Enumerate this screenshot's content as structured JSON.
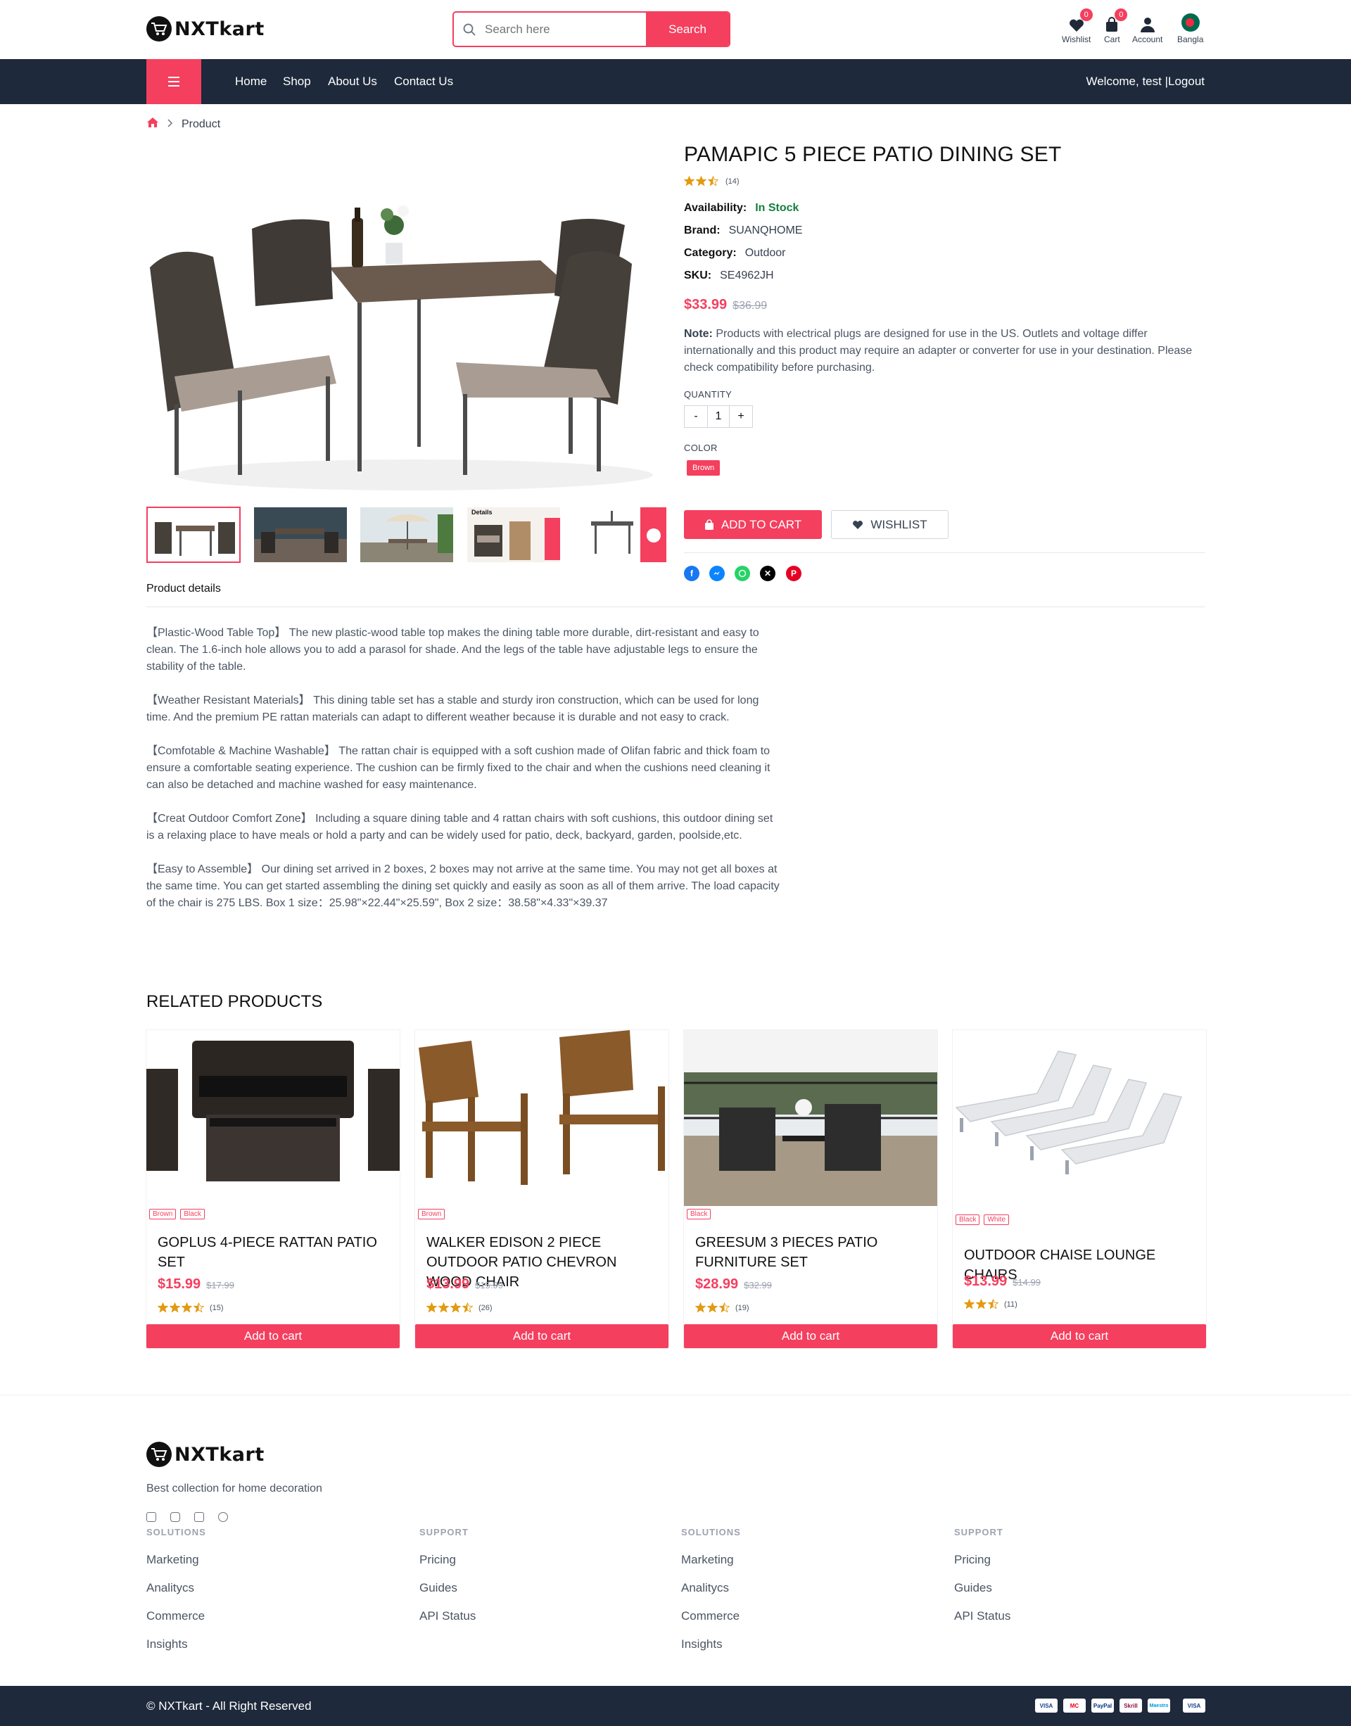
{
  "brand": {
    "name": "NXTkart",
    "accent": "#f43f5e",
    "dark": "#1e293b"
  },
  "search": {
    "placeholder": "Search here",
    "button": "Search"
  },
  "header_icons": [
    {
      "label": "Wishlist",
      "badge": "0",
      "icon": "heart-icon"
    },
    {
      "label": "Cart",
      "badge": "0",
      "icon": "shopping-bag-icon"
    },
    {
      "label": "Account",
      "icon": "user-icon"
    },
    {
      "label": "Bangla",
      "icon": "bangladesh-flag-icon"
    }
  ],
  "nav": {
    "links": [
      "Home",
      "Shop",
      "About Us",
      "Contact Us"
    ],
    "welcome": "Welcome, test |",
    "logout": "Logout"
  },
  "breadcrumb": {
    "current": "Product"
  },
  "product": {
    "title": "PAMAPIC 5 PIECE PATIO DINING SET",
    "rating": 2.5,
    "reviews": "(14)",
    "availability_label": "Availability:",
    "availability": "In Stock",
    "brand_label": "Brand:",
    "brand": "SUANQHOME",
    "category_label": "Category:",
    "category": "Outdoor",
    "sku_label": "SKU:",
    "sku": "SE4962JH",
    "price": "$33.99",
    "old_price": "$36.99",
    "note_label": "Note:",
    "note": "Products with electrical plugs are designed for use in the US. Outlets and voltage differ internationally and this product may require an adapter or converter for use in your destination. Please check compatibility before purchasing.",
    "quantity_label": "QUANTITY",
    "quantity": "1",
    "qty_minus": "-",
    "qty_plus": "+",
    "color_label": "COLOR",
    "color": "Brown",
    "add_to_cart": "ADD TO CART",
    "wishlist": "WISHLIST",
    "details_tab": "Product details",
    "share": [
      "facebook-icon",
      "messenger-icon",
      "whatsapp-icon",
      "x-icon",
      "pinterest-icon"
    ],
    "description": [
      "【Plastic-Wood Table Top】 The new plastic-wood table top makes the dining table more durable, dirt-resistant and easy to clean. The 1.6-inch hole allows you to add a parasol for shade. And the legs of the table have adjustable legs to ensure the stability of the table.",
      "【Weather Resistant Materials】 This dining table set has a stable and sturdy iron construction, which can be used for long time. And the premium PE rattan materials can adapt to different weather because it is durable and not easy to crack.",
      "【Comfotable & Machine Washable】 The rattan chair is equipped with a soft cushion made of Olifan fabric and thick foam to ensure a comfortable seating experience. The cushion can be firmly fixed to the chair and when the cushions need cleaning it can also be detached and machine washed for easy maintenance.",
      "【Creat Outdoor Comfort Zone】 Including a square dining table and 4 rattan chairs with soft cushions, this outdoor dining set is a relaxing place to have meals or hold a party and can be widely used for patio, deck, backyard, garden, poolside,etc.",
      "【Easy to Assemble】 Our dining set arrived in 2 boxes, 2 boxes may not arrive at the same time. You may not get all boxes at the same time. You can get started assembling the dining set quickly and easily as soon as all of them arrive. The load capacity of the chair is 275 LBS. Box 1 size：25.98\"×22.44\"×25.59\", Box 2 size：38.58\"×4.33\"×39.37"
    ],
    "thumb_caption": "Details"
  },
  "related": {
    "heading": "RELATED PRODUCTS",
    "add_label": "Add to cart",
    "items": [
      {
        "name": "GOPLUS 4-PIECE RATTAN PATIO SET",
        "price": "$15.99",
        "old": "$17.99",
        "rating": 3.5,
        "count": "(15)",
        "tags": [
          "Brown",
          "Black"
        ]
      },
      {
        "name": "WALKER EDISON 2 PIECE OUTDOOR PATIO CHEVRON WOOD CHAIR",
        "price": "$13.99",
        "old": "$15.99",
        "rating": 3.5,
        "count": "(26)",
        "tags": [
          "Brown"
        ]
      },
      {
        "name": "GREESUM 3 PIECES PATIO FURNITURE SET",
        "price": "$28.99",
        "old": "$32.99",
        "rating": 2.5,
        "count": "(19)",
        "tags": [
          "Black"
        ]
      },
      {
        "name": "OUTDOOR CHAISE LOUNGE CHAIRS",
        "price": "$13.99",
        "old": "$14.99",
        "rating": 2.5,
        "count": "(11)",
        "tags": [
          "Black",
          "White"
        ]
      }
    ]
  },
  "footer": {
    "tagline": "Best collection for home decoration",
    "social": [
      "facebook-icon",
      "instagram-icon",
      "twitter-icon",
      "github-icon"
    ],
    "columns": [
      {
        "heading": "SOLUTIONS",
        "links": [
          "Marketing",
          "Analitycs",
          "Commerce",
          "Insights"
        ]
      },
      {
        "heading": "SUPPORT",
        "links": [
          "Pricing",
          "Guides",
          "API Status"
        ]
      },
      {
        "heading": "SOLUTIONS",
        "links": [
          "Marketing",
          "Analitycs",
          "Commerce",
          "Insights"
        ]
      },
      {
        "heading": "SUPPORT",
        "links": [
          "Pricing",
          "Guides",
          "API Status"
        ]
      }
    ],
    "copyright": "© NXTkart - All Right Reserved",
    "payments": [
      "VISA",
      "MC",
      "PayPal",
      "Skrill",
      "Maestro",
      "VISA"
    ]
  }
}
